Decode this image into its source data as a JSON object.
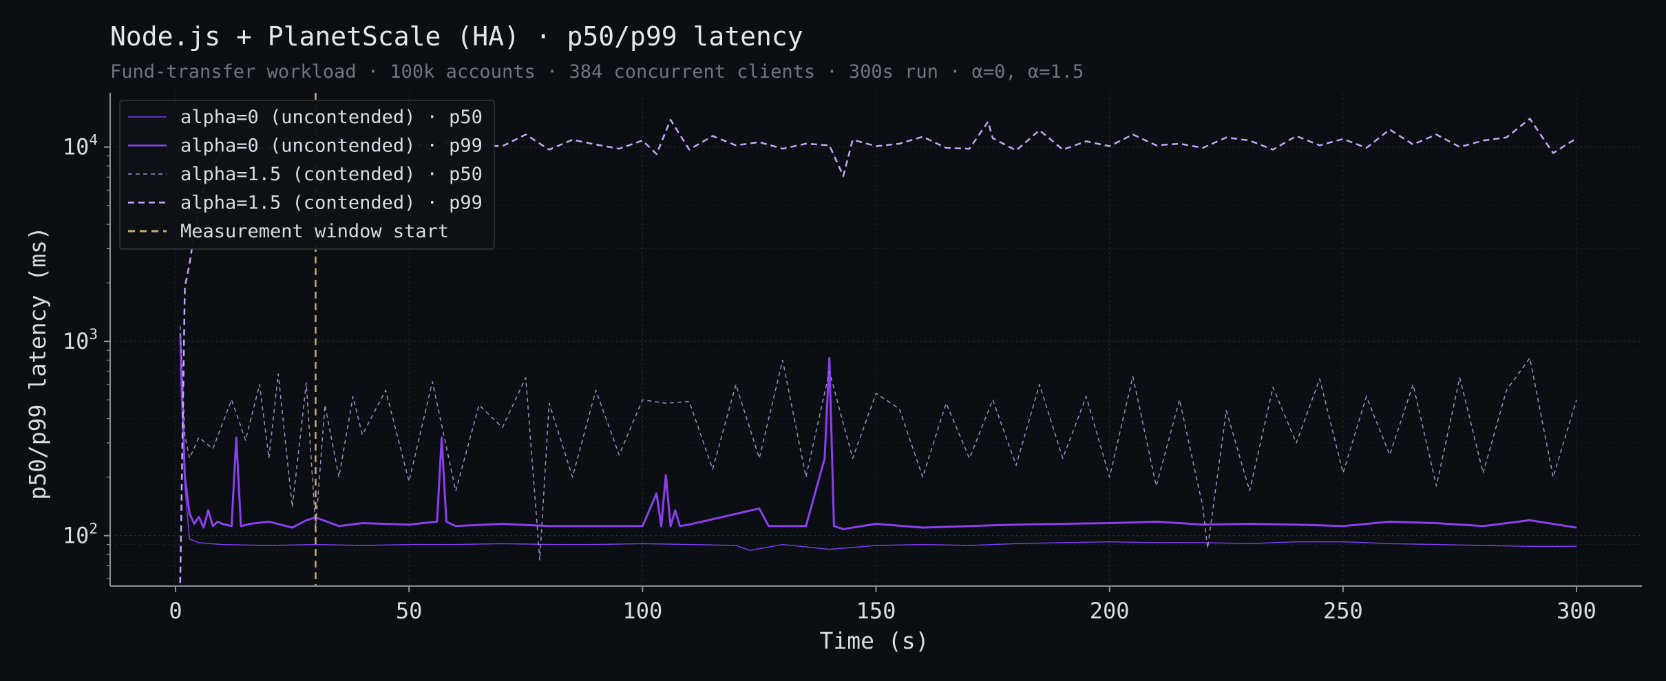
{
  "title": "Node.js + PlanetScale (HA) · p50/p99 latency",
  "subtitle": "Fund-transfer workload · 100k accounts · 384 concurrent clients · 300s run · α=0, α=1.5",
  "chart_data": {
    "type": "line",
    "xlabel": "Time (s)",
    "ylabel": "p50/p99 latency (ms)",
    "xlim": [
      -14,
      314
    ],
    "ylim": [
      55,
      19000
    ],
    "yscale": "log",
    "x_ticks": [
      0,
      50,
      100,
      150,
      200,
      250,
      300
    ],
    "y_ticks": [
      {
        "base": "10",
        "exp": "2",
        "value": 100
      },
      {
        "base": "10",
        "exp": "3",
        "value": 1000
      },
      {
        "base": "10",
        "exp": "4",
        "value": 10000
      }
    ],
    "grid": true,
    "legend_position": "top-left",
    "colors": {
      "background": "#0b0e12",
      "text": "#d9dce3",
      "muted": "#6f7580",
      "axis": "#8a9099",
      "grid": "#262b33",
      "marker": "#c9ab6a"
    },
    "series": [
      {
        "name": "alpha=0 (uncontended) · p50",
        "color": "#7c3aed",
        "dash": "",
        "width": 1.5,
        "x": [
          1,
          2,
          3,
          5,
          10,
          20,
          30,
          40,
          50,
          60,
          70,
          80,
          90,
          100,
          110,
          120,
          123,
          130,
          140,
          150,
          160,
          170,
          180,
          190,
          200,
          210,
          220,
          230,
          240,
          250,
          260,
          270,
          280,
          290,
          300
        ],
        "y": [
          760,
          180,
          96,
          92,
          90,
          89,
          90,
          89,
          90,
          90,
          91,
          90,
          90,
          91,
          90,
          89,
          84,
          90,
          85,
          89,
          90,
          89,
          91,
          92,
          93,
          92,
          92,
          91,
          93,
          93,
          91,
          90,
          89,
          88,
          88
        ]
      },
      {
        "name": "alpha=0 (uncontended) · p99",
        "color": "#8b40f0",
        "dash": "",
        "width": 3,
        "x": [
          1,
          2,
          3,
          4,
          5,
          6,
          7,
          8,
          9,
          10,
          12,
          13,
          14,
          16,
          20,
          25,
          28,
          30,
          35,
          40,
          50,
          56,
          57,
          58,
          60,
          70,
          80,
          100,
          103,
          104,
          105,
          106,
          107,
          108,
          110,
          125,
          127,
          135,
          139,
          140,
          141,
          143,
          150,
          160,
          170,
          180,
          190,
          200,
          210,
          220,
          230,
          240,
          250,
          260,
          270,
          280,
          290,
          300
        ],
        "y": [
          1100,
          200,
          130,
          115,
          125,
          110,
          135,
          112,
          118,
          115,
          112,
          320,
          112,
          115,
          118,
          110,
          120,
          124,
          112,
          116,
          114,
          118,
          320,
          118,
          112,
          115,
          112,
          112,
          165,
          112,
          205,
          112,
          135,
          112,
          114,
          138,
          112,
          112,
          250,
          820,
          112,
          108,
          115,
          110,
          112,
          114,
          115,
          116,
          118,
          114,
          115,
          114,
          112,
          118,
          116,
          112,
          120,
          110
        ]
      },
      {
        "name": "alpha=1.5 (contended) · p50",
        "color": "#9a8fc4",
        "dash": "6 5",
        "width": 1.5,
        "x": [
          1,
          2,
          3,
          5,
          8,
          12,
          15,
          18,
          20,
          22,
          25,
          28,
          30,
          32,
          35,
          38,
          40,
          45,
          50,
          55,
          60,
          65,
          70,
          75,
          78,
          80,
          85,
          90,
          95,
          100,
          105,
          110,
          115,
          120,
          125,
          130,
          135,
          140,
          145,
          150,
          155,
          160,
          165,
          170,
          175,
          180,
          185,
          190,
          195,
          200,
          205,
          210,
          215,
          220,
          221,
          225,
          230,
          235,
          240,
          245,
          250,
          255,
          260,
          265,
          270,
          275,
          280,
          285,
          290,
          295,
          300
        ],
        "y": [
          1200,
          330,
          250,
          320,
          280,
          500,
          310,
          600,
          250,
          680,
          140,
          610,
          110,
          470,
          200,
          520,
          330,
          560,
          190,
          620,
          170,
          470,
          360,
          650,
          75,
          480,
          200,
          560,
          260,
          500,
          480,
          490,
          220,
          600,
          250,
          800,
          200,
          700,
          250,
          540,
          450,
          200,
          480,
          250,
          500,
          230,
          600,
          250,
          520,
          200,
          660,
          180,
          500,
          140,
          86,
          440,
          170,
          580,
          300,
          640,
          210,
          520,
          260,
          600,
          180,
          650,
          210,
          560,
          820,
          200,
          500
        ]
      },
      {
        "name": "alpha=1.5 (contended) · p99",
        "color": "#c4a8f5",
        "dash": "9 6",
        "width": 2.5,
        "x": [
          1,
          2,
          3,
          4,
          5,
          6,
          8,
          10,
          15,
          20,
          25,
          30,
          35,
          40,
          45,
          50,
          55,
          60,
          65,
          70,
          75,
          80,
          85,
          90,
          95,
          100,
          103,
          106,
          110,
          115,
          120,
          125,
          130,
          135,
          140,
          143,
          145,
          150,
          155,
          160,
          165,
          170,
          174,
          175,
          180,
          185,
          190,
          195,
          200,
          205,
          210,
          215,
          220,
          225,
          230,
          235,
          240,
          245,
          250,
          255,
          260,
          265,
          270,
          275,
          280,
          285,
          290,
          295,
          300
        ],
        "y": [
          57,
          1900,
          2500,
          3600,
          4600,
          6000,
          8000,
          9600,
          10100,
          9800,
          10500,
          9700,
          11000,
          9900,
          10400,
          10800,
          9600,
          11200,
          10200,
          10100,
          11600,
          9700,
          10900,
          10300,
          9800,
          10800,
          9200,
          13800,
          9700,
          11400,
          10200,
          10600,
          9800,
          10400,
          10200,
          7100,
          10900,
          10100,
          10400,
          11300,
          9900,
          9800,
          13500,
          11100,
          9600,
          12200,
          9700,
          10700,
          10100,
          11600,
          10200,
          10400,
          9900,
          11200,
          10800,
          9700,
          11400,
          10200,
          11000,
          9900,
          12300,
          10300,
          11600,
          10000,
          10800,
          11200,
          14000,
          9300,
          11100
        ]
      }
    ],
    "reference_line": {
      "name": "Measurement window start",
      "x": 30,
      "color": "#c9ab6a"
    }
  }
}
